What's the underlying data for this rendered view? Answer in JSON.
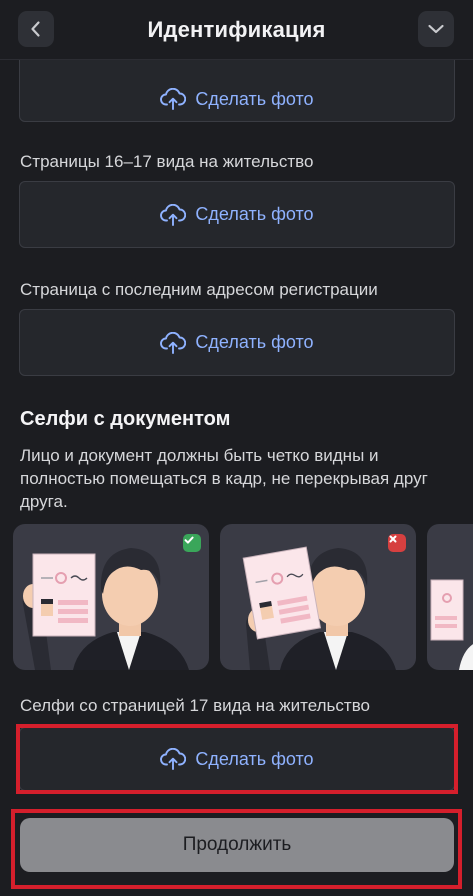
{
  "header": {
    "title": "Идентификация",
    "back_icon": "chevron-left-icon",
    "menu_icon": "chevron-down-icon"
  },
  "upload_label": "Сделать фото",
  "fields": [
    {
      "label": ""
    },
    {
      "label": "Страницы 16–17 вида на жительство"
    },
    {
      "label": "Страница с последним адресом регистрации"
    }
  ],
  "selfie": {
    "title": "Селфи с документом",
    "description": "Лицо и документ должны быть четко видны и полностью помещаться в кадр, не перекрывая друг друга.",
    "examples": [
      {
        "status": "correct",
        "badge_icon": "check-icon",
        "badge_color": "#3aa65a"
      },
      {
        "status": "incorrect",
        "badge_icon": "close-icon",
        "badge_color": "#d64040"
      },
      {
        "status": "partial",
        "badge_icon": "",
        "badge_color": ""
      }
    ],
    "field_label": "Селфи со страницей 17 вида на жительство"
  },
  "continue_label": "Продолжить",
  "colors": {
    "background": "#1c1d21",
    "accent": "#8fb2ff",
    "highlight": "#d51f2c",
    "button_disabled": "#8a8b8f"
  }
}
